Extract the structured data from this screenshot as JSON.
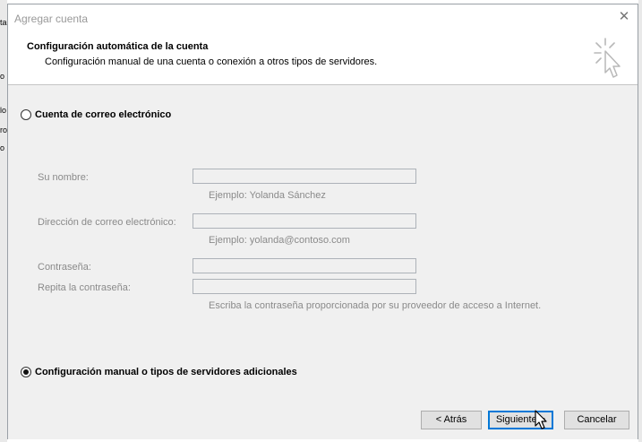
{
  "background": {
    "left_fragments": [
      "ta",
      "o",
      "lo",
      "ro",
      "o"
    ]
  },
  "dialog": {
    "title": "Agregar cuenta",
    "close_glyph": "✕"
  },
  "header": {
    "title": "Configuración automática de la cuenta",
    "subtitle": "Configuración manual de una cuenta o conexión a otros tipos de servidores."
  },
  "options": {
    "email_account": {
      "label": "Cuenta de correo electrónico",
      "selected": false
    },
    "manual_config": {
      "label": "Configuración manual o tipos de servidores adicionales",
      "selected": true
    }
  },
  "form": {
    "name": {
      "label": "Su nombre:",
      "value": "",
      "hint": "Ejemplo: Yolanda Sánchez"
    },
    "email": {
      "label": "Dirección de correo electrónico:",
      "value": "",
      "hint": "Ejemplo: yolanda@contoso.com"
    },
    "password": {
      "label": "Contraseña:",
      "value": ""
    },
    "repeat_password": {
      "label": "Repita la contraseña:",
      "value": "",
      "hint": "Escriba la contraseña proporcionada por su proveedor de acceso a Internet."
    }
  },
  "buttons": {
    "back": "< Atrás",
    "next": "Siguiente >",
    "cancel": "Cancelar"
  },
  "colors": {
    "accent": "#0078d7",
    "disabled_text": "#8a8a8a",
    "panel": "#f0f0f0"
  }
}
